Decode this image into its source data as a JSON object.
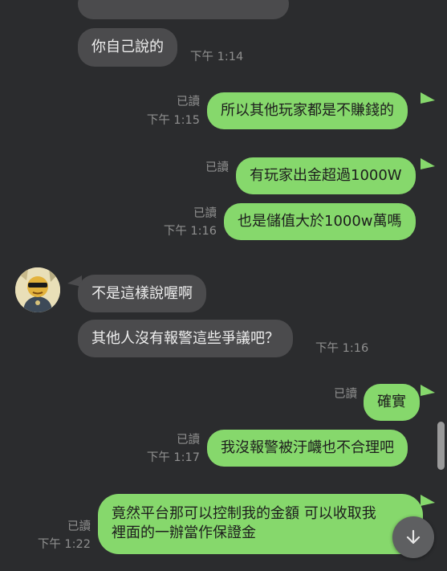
{
  "colors": {
    "background": "#2b2c2e",
    "incoming_bubble": "#4b4b4d",
    "outgoing_bubble": "#86d86c",
    "meta_text": "#8f8f8f"
  },
  "messages": [
    {
      "id": "m1",
      "direction": "incoming",
      "text": "你自己說的",
      "time": "下午 1:14"
    },
    {
      "id": "m2",
      "direction": "outgoing",
      "text": "所以其他玩家都是不賺錢的",
      "read": "已讀",
      "time": "下午 1:15"
    },
    {
      "id": "m3",
      "direction": "outgoing",
      "text": "有玩家出金超過1000W",
      "read": "已讀"
    },
    {
      "id": "m4",
      "direction": "outgoing",
      "text": "也是儲值大於1000w萬嗎",
      "read": "已讀",
      "time": "下午 1:16"
    },
    {
      "id": "m5",
      "direction": "incoming",
      "text": "不是這樣說喔啊",
      "avatar_icon": "contact-avatar"
    },
    {
      "id": "m6",
      "direction": "incoming",
      "text": "其他人沒有報警這些爭議吧？",
      "time": "下午 1:16"
    },
    {
      "id": "m7",
      "direction": "outgoing",
      "text": "確實",
      "read": "已讀"
    },
    {
      "id": "m8",
      "direction": "outgoing",
      "text": "我沒報警被汙衊也不合理吧",
      "read": "已讀",
      "time": "下午 1:17"
    },
    {
      "id": "m9",
      "direction": "outgoing",
      "lines": [
        "竟然平台那可以控制我的金額 可以收取我",
        "裡面的一辦當作保證金"
      ],
      "read": "已讀",
      "time": "下午 1:22"
    }
  ],
  "controls": {
    "scroll_to_bottom_icon": "arrow-down-icon"
  }
}
